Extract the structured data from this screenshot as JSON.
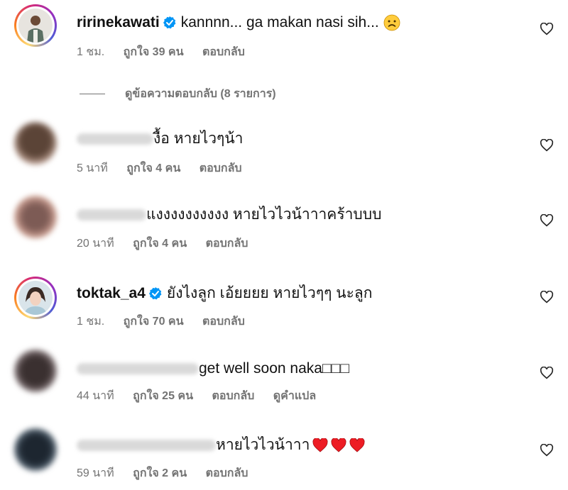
{
  "comments": [
    {
      "username": "ririnekawati",
      "verified": true,
      "text": "kannnn... ga makan nasi sih...",
      "emoji": "sad-face-emoji",
      "time": "1 ชม.",
      "likes": "ถูกใจ 39 คน",
      "reply": "ตอบกลับ",
      "translate": ""
    },
    {
      "username": "",
      "verified": false,
      "text": "งื้อ หายไวๆน้า",
      "time": "5 นาที",
      "likes": "ถูกใจ 4 คน",
      "reply": "ตอบกลับ"
    },
    {
      "username": "",
      "verified": false,
      "text": "แงงงงงงงงงง หายไวไวน้าาาคร้าบบบ",
      "time": "20 นาที",
      "likes": "ถูกใจ 4 คน",
      "reply": "ตอบกลับ"
    },
    {
      "username": "toktak_a4",
      "verified": true,
      "text": "ยังไงลูก เอ้ยยยย หายไวๆๆ นะลูก",
      "time": "1 ชม.",
      "likes": "ถูกใจ 70 คน",
      "reply": "ตอบกลับ"
    },
    {
      "username": "",
      "verified": false,
      "text": "get well soon naka□□□",
      "time": "44 นาที",
      "likes": "ถูกใจ 25 คน",
      "reply": "ตอบกลับ",
      "translate": "ดูคำแปล"
    },
    {
      "username": "",
      "verified": false,
      "text": "หายไวไวน้าาา",
      "emoji": "red-heart-emoji x3",
      "time": "59 นาที",
      "likes": "ถูกใจ 2 คน",
      "reply": "ตอบกลับ"
    }
  ],
  "view_replies": "ดูข้อความตอบกลับ (8 รายการ)",
  "colors": {
    "meta_gray": "#737373",
    "verified_blue": "#0095f6",
    "heart_red": "#ed1c24"
  },
  "icons": [
    "heart-outline-icon",
    "verified-badge-icon"
  ]
}
